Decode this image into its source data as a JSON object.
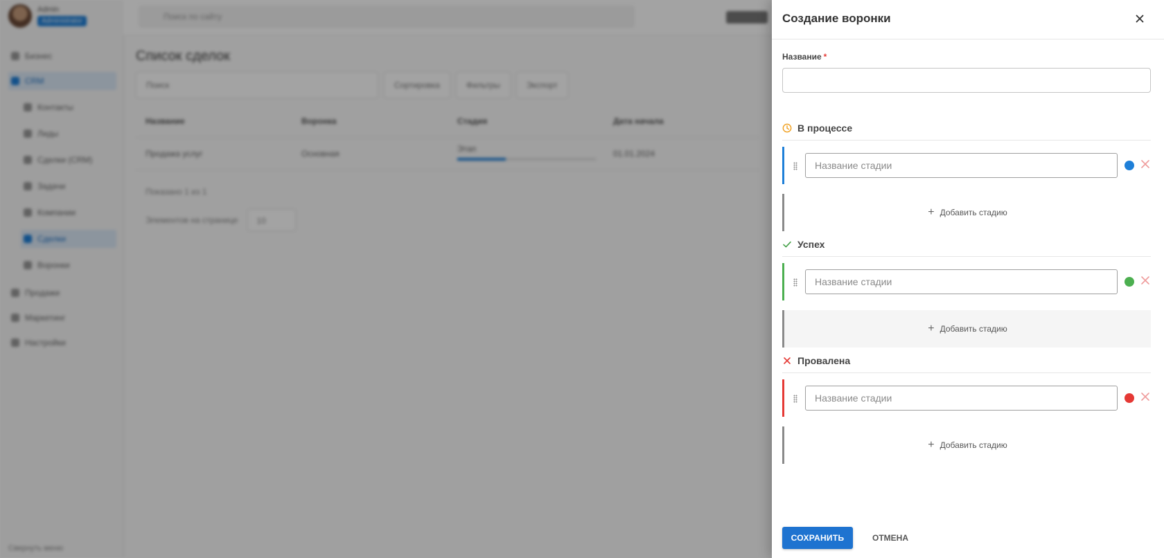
{
  "background": {
    "user_name": "Admin",
    "user_role": "Administrator",
    "search_placeholder": "Поиск по сайту",
    "sidebar_items": [
      "Бизнес",
      "CRM",
      "Контакты",
      "Лиды",
      "Сделки (CRM)",
      "Задачи",
      "Компании",
      "Сделки",
      "Воронки",
      "Продажи",
      "Маркетинг",
      "Настройки"
    ],
    "page_title": "Список сделок",
    "toolbar": [
      "Поиск",
      "Сортировка",
      "Фильтры",
      "Экспорт"
    ],
    "table_headers": [
      "Название",
      "Воронка",
      "Стадия",
      "Дата начала"
    ],
    "table_row": [
      "Продажа услуг",
      "Основная",
      "Этап",
      "01.01.2024"
    ],
    "pager_info": "Показано 1 из 1",
    "rows_per_page_label": "Элементов на странице",
    "rows_per_page_value": "10",
    "bottom_label": "Свернуть меню"
  },
  "drawer": {
    "title": "Создание воронки",
    "close_icon": "close-icon",
    "name_field": {
      "label": "Название",
      "required_mark": "*",
      "value": "",
      "placeholder": ""
    },
    "sections": [
      {
        "title": "В процессе",
        "icon": "clock-icon",
        "icon_color": "#f0a020",
        "bar_color": "#1e7fd8",
        "stage_placeholder": "Название стадии",
        "stage_value": "",
        "dot_color": "#1e7fd8",
        "add_label": "Добавить стадию"
      },
      {
        "title": "Успех",
        "icon": "check-icon",
        "icon_color": "#43a047",
        "bar_color": "#4caf50",
        "stage_placeholder": "Название стадии",
        "stage_value": "",
        "dot_color": "#4caf50",
        "add_label": "Добавить стадию"
      },
      {
        "title": "Провалена",
        "icon": "x-icon",
        "icon_color": "#e53935",
        "bar_color": "#e53935",
        "stage_placeholder": "Название стадии",
        "stage_value": "",
        "dot_color": "#e53935",
        "add_label": "Добавить стадию"
      }
    ],
    "save_label": "СОХРАНИТЬ",
    "cancel_label": "ОТМЕНА"
  }
}
